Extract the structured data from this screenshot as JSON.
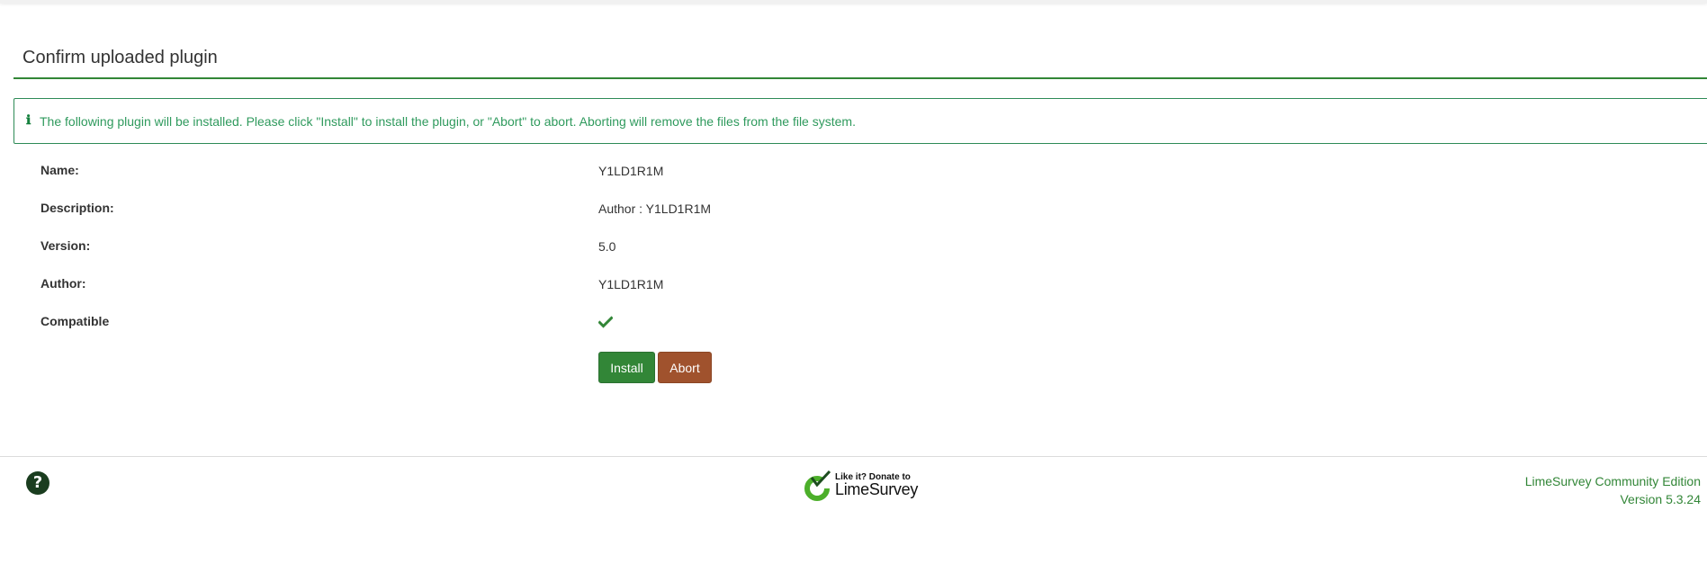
{
  "header": {
    "title": "Confirm uploaded plugin"
  },
  "alert": {
    "icon": "info-icon",
    "message": "The following plugin will be installed. Please click \"Install\" to install the plugin, or \"Abort\" to abort. Aborting will remove the files from the file system."
  },
  "plugin": {
    "rows": [
      {
        "label": "Name:",
        "value": "Y1LD1R1M"
      },
      {
        "label": "Description:",
        "value": "Author : Y1LD1R1M"
      },
      {
        "label": "Version:",
        "value": "5.0"
      },
      {
        "label": "Author:",
        "value": "Y1LD1R1M"
      },
      {
        "label": "Compatible",
        "value_icon": "check-icon"
      }
    ]
  },
  "actions": {
    "install_label": "Install",
    "abort_label": "Abort"
  },
  "footer": {
    "help_icon": "question-circle-icon",
    "donate_line1": "Like it? Donate to",
    "donate_line2": "LimeSurvey",
    "edition": "LimeSurvey Community Edition",
    "version": "Version 5.3.24"
  },
  "colors": {
    "primary": "#328637",
    "abort": "#a0522d",
    "alert_text": "#2f9a5d"
  }
}
